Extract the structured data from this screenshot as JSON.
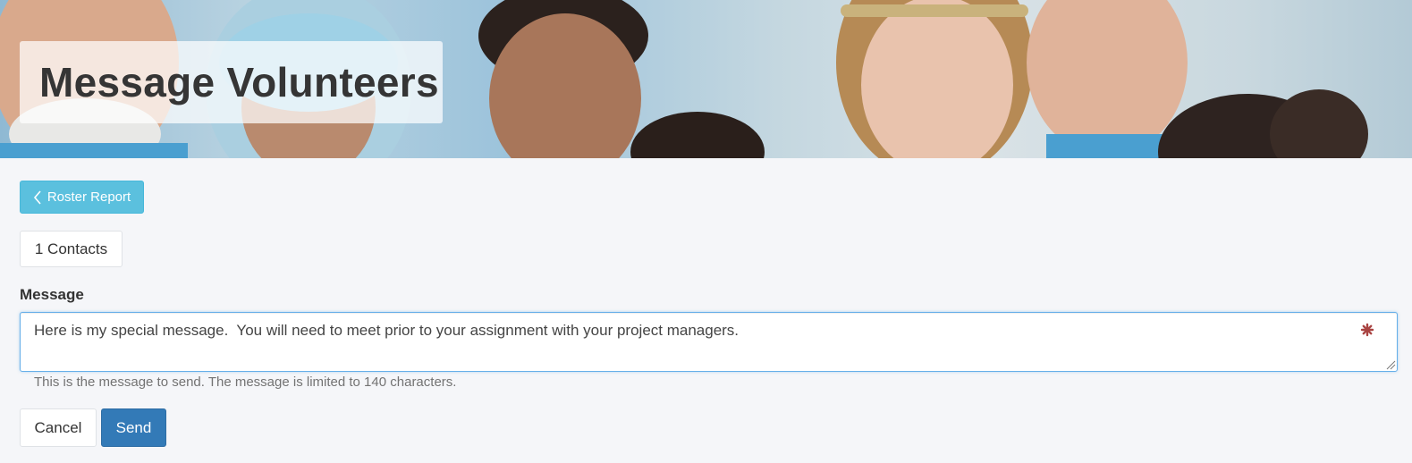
{
  "header": {
    "title": "Message Volunteers",
    "banner_image": "volunteers-group-photo"
  },
  "back_button": {
    "label": "Roster Report",
    "icon": "chevron-left-icon"
  },
  "contacts": {
    "label": "1 Contacts"
  },
  "message": {
    "label": "Message",
    "value": "Here is my special message.  You will need to meet prior to your assignment with your project managers.",
    "help_text": "This is the message to send. The message is limited to 140 characters.",
    "required_icon": "asterisk-icon"
  },
  "actions": {
    "cancel_label": "Cancel",
    "send_label": "Send"
  },
  "colors": {
    "info_button": "#5bc0de",
    "primary_button": "#337ab7",
    "required": "#a94442",
    "page_background": "#f5f6f9"
  }
}
